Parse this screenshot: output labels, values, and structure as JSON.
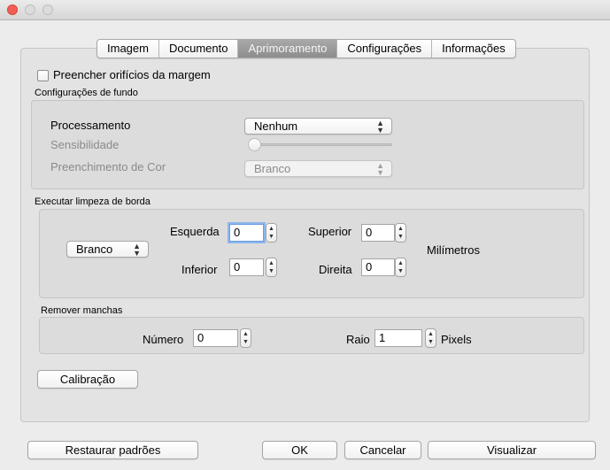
{
  "tabs": [
    "Imagem",
    "Documento",
    "Aprimoramento",
    "Configurações",
    "Informações"
  ],
  "fill_holes": {
    "label": "Preencher orifícios da margem",
    "checked": false
  },
  "background_settings": {
    "title": "Configurações de fundo",
    "processing_label": "Processamento",
    "processing_value": "Nenhum",
    "sensitivity_label": "Sensibilidade",
    "sensitivity_value": 0,
    "color_fill_label": "Preenchimento de Cor",
    "color_fill_value": "Branco"
  },
  "edge_cleanup": {
    "title": "Executar limpeza de borda",
    "color_value": "Branco",
    "left_label": "Esquerda",
    "left_value": "0",
    "top_label": "Superior",
    "top_value": "0",
    "bottom_label": "Inferior",
    "bottom_value": "0",
    "right_label": "Direita",
    "right_value": "0",
    "unit_label": "Milímetros"
  },
  "remove_spots": {
    "title": "Remover manchas",
    "number_label": "Número",
    "number_value": "0",
    "radius_label": "Raio",
    "radius_value": "1",
    "unit_label": "Pixels"
  },
  "calibration_label": "Calibração",
  "footer": {
    "restore_label": "Restaurar padrões",
    "ok_label": "OK",
    "cancel_label": "Cancelar",
    "preview_label": "Visualizar"
  },
  "colors": {
    "active_tab": "#989898",
    "close_button": "#f25f55",
    "focus_ring": "#8db6ec"
  },
  "icons": {
    "popup_arrows": "updown-arrows-icon",
    "stepper": "stepper-arrows-icon"
  }
}
